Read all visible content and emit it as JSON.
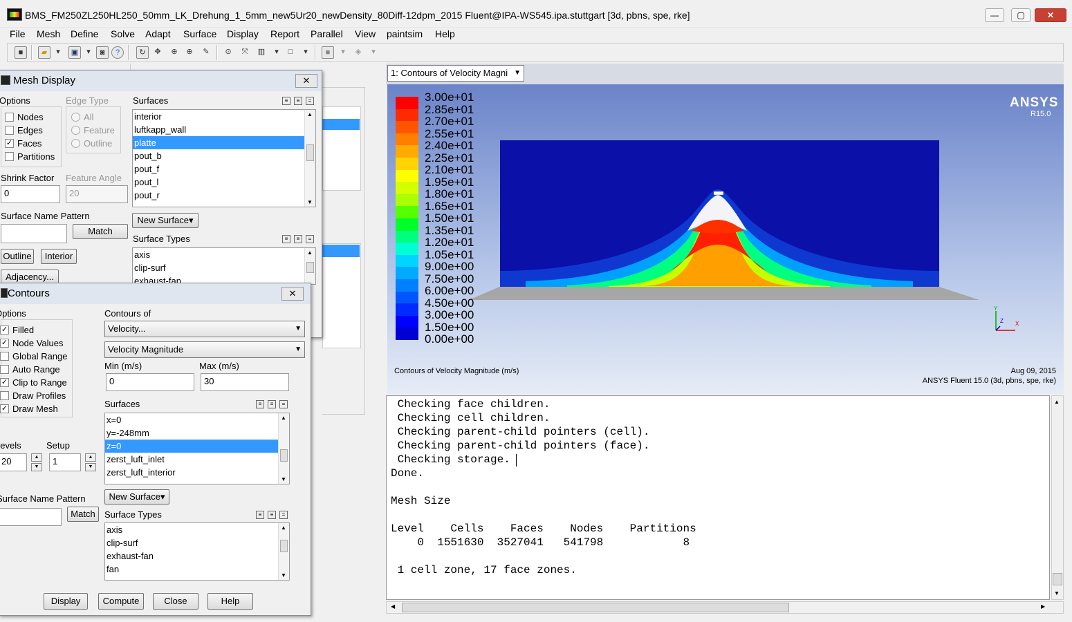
{
  "window": {
    "title": "BMS_FM250ZL250HL250_50mm_LK_Drehung_1_5mm_new5Ur20_newDensity_80Diff-12dpm_2015 Fluent@IPA-WS545.ipa.stuttgart  [3d, pbns, spe, rke]",
    "buttons": {
      "minimize": "—",
      "maximize": "▢",
      "close": "✕"
    }
  },
  "menu": [
    "File",
    "Mesh",
    "Define",
    "Solve",
    "Adapt",
    "Surface",
    "Display",
    "Report",
    "Parallel",
    "View",
    "paintsim",
    "Help"
  ],
  "graphics": {
    "window_selector": "1: Contours of Velocity Magni",
    "brand": "ANSYS",
    "brand_version": "R15.0",
    "caption": "Contours of Velocity Magnitude (m/s)",
    "date": "Aug 09, 2015",
    "product": "ANSYS Fluent 15.0 (3d, pbns, spe, rke)",
    "legend_labels": [
      "3.00e+01",
      "2.85e+01",
      "2.70e+01",
      "2.55e+01",
      "2.40e+01",
      "2.25e+01",
      "2.10e+01",
      "1.95e+01",
      "1.80e+01",
      "1.65e+01",
      "1.50e+01",
      "1.35e+01",
      "1.20e+01",
      "1.05e+01",
      "9.00e+00",
      "7.50e+00",
      "6.00e+00",
      "4.50e+00",
      "3.00e+00",
      "1.50e+00",
      "0.00e+00"
    ],
    "legend_colors": [
      "#ff0000",
      "#ff2a00",
      "#ff5500",
      "#ff7f00",
      "#ffaa00",
      "#ffd400",
      "#ffff00",
      "#d4ff00",
      "#aaff00",
      "#55ff00",
      "#00ff2a",
      "#00ff7f",
      "#00ffd4",
      "#00d4ff",
      "#00aaff",
      "#007fff",
      "#0055ff",
      "#002aff",
      "#0000ff",
      "#0000d4"
    ],
    "axes": {
      "y": "Y",
      "x": "X",
      "z": "Z"
    }
  },
  "console": {
    "text": " Checking face children.\n Checking cell children.\n Checking parent-child pointers (cell).\n Checking parent-child pointers (face).\n Checking storage.\nDone.\n\nMesh Size\n\nLevel    Cells    Faces    Nodes    Partitions\n    0  1551630  3527041   541798            8\n\n 1 cell zone, 17 face zones."
  },
  "mesh_display": {
    "title": "Mesh Display",
    "options_label": "Options",
    "options": [
      {
        "label": "Nodes",
        "checked": false
      },
      {
        "label": "Edges",
        "checked": false
      },
      {
        "label": "Faces",
        "checked": true
      },
      {
        "label": "Partitions",
        "checked": false
      }
    ],
    "edge_type_label": "Edge Type",
    "edge_types": [
      "All",
      "Feature",
      "Outline"
    ],
    "surfaces_label": "Surfaces",
    "surfaces": [
      "interior",
      "luftkapp_wall",
      "platte",
      "pout_b",
      "pout_f",
      "pout_l",
      "pout_r"
    ],
    "selected_surface": "platte",
    "shrink_factor_label": "Shrink Factor",
    "shrink_factor": "0",
    "feature_angle_label": "Feature Angle",
    "feature_angle": "20",
    "surface_name_pattern_label": "Surface Name Pattern",
    "match_button": "Match",
    "new_surface_button": "New Surface",
    "outline_button": "Outline",
    "interior_button": "Interior",
    "adjacency_button": "Adjacency...",
    "surface_types_label": "Surface Types",
    "surface_types": [
      "axis",
      "clip-surf",
      "exhaust-fan"
    ]
  },
  "contours": {
    "title": "Contours",
    "options_label": "Options",
    "options": [
      {
        "label": "Filled",
        "checked": true
      },
      {
        "label": "Node Values",
        "checked": true
      },
      {
        "label": "Global Range",
        "checked": false
      },
      {
        "label": "Auto Range",
        "checked": false
      },
      {
        "label": "Clip to Range",
        "checked": true
      },
      {
        "label": "Draw Profiles",
        "checked": false
      },
      {
        "label": "Draw Mesh",
        "checked": true
      }
    ],
    "contours_of_label": "Contours of",
    "contours_of": "Velocity...",
    "contours_sub": "Velocity Magnitude",
    "min_label": "Min (m/s)",
    "min": "0",
    "max_label": "Max (m/s)",
    "max": "30",
    "surfaces_label": "Surfaces",
    "surfaces": [
      "x=0",
      "y=-248mm",
      "z=0",
      "zerst_luft_inlet",
      "zerst_luft_interior"
    ],
    "selected_surface": "z=0",
    "levels_label": "Levels",
    "levels": "20",
    "setup_label": "Setup",
    "setup": "1",
    "surface_name_pattern_label": "Surface Name Pattern",
    "match_button": "Match",
    "new_surface_button": "New Surface",
    "surface_types_label": "Surface Types",
    "surface_types": [
      "axis",
      "clip-surf",
      "exhaust-fan",
      "fan"
    ],
    "buttons": [
      "Display",
      "Compute",
      "Close",
      "Help"
    ]
  }
}
